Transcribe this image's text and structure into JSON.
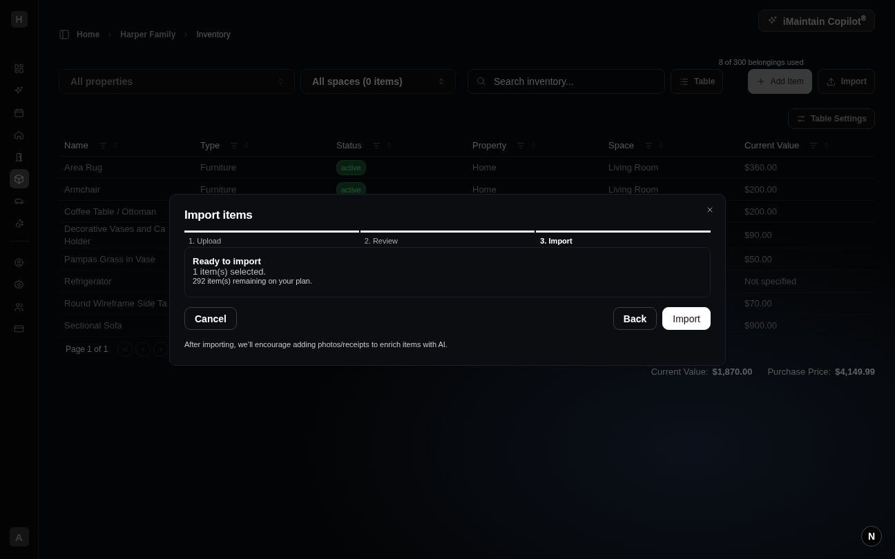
{
  "sidebar": {
    "logo": "H",
    "items": [
      {
        "kind": "grid",
        "selected": false
      },
      {
        "kind": "sparkles",
        "selected": false
      },
      {
        "kind": "calendar",
        "selected": false
      },
      {
        "kind": "home",
        "selected": false
      },
      {
        "kind": "door",
        "selected": false
      },
      {
        "kind": "box",
        "selected": true
      },
      {
        "kind": "car",
        "selected": false
      },
      {
        "kind": "paw",
        "selected": false
      }
    ],
    "bottom_items": [
      {
        "kind": "user"
      },
      {
        "kind": "gear"
      },
      {
        "kind": "users"
      },
      {
        "kind": "card"
      }
    ],
    "avatar": "A"
  },
  "copilot": {
    "label": "iMaintain Copilot",
    "mark": "®"
  },
  "breadcrumb": [
    {
      "label": "Home",
      "current": false
    },
    {
      "label": "Harper Family",
      "current": false
    },
    {
      "label": "Inventory",
      "current": true
    }
  ],
  "filters": [
    {
      "value": "All properties"
    },
    {
      "value": "All spaces (0 items)"
    }
  ],
  "search": {
    "placeholder": "Search inventory..."
  },
  "view_button": "Table",
  "usage": "8 of 300 belongings used",
  "add_button": "Add Item",
  "import_button": "Import",
  "table_settings": "Table Settings",
  "table": {
    "columns": [
      "Name",
      "Type",
      "Status",
      "Property",
      "Space",
      "Current Value"
    ],
    "rows": [
      {
        "name": "Area Rug",
        "type": "Furniture",
        "status": "active",
        "property": "Home",
        "space": "Living Room",
        "value": "$360.00"
      },
      {
        "name": "Armchair",
        "type": "Furniture",
        "status": "active",
        "property": "Home",
        "space": "Living Room",
        "value": "$200.00"
      },
      {
        "name": "Coffee Table / Ottoman",
        "value": "$200.00"
      },
      {
        "name": "Decorative Vases and Ca\nHolder",
        "value": "$90.00"
      },
      {
        "name": "Pampas Grass in Vase",
        "value": "$50.00"
      },
      {
        "name": "Refrigerator",
        "value": "Not specified"
      },
      {
        "name": "Round Wireframe Side Ta",
        "value": "$70.00"
      },
      {
        "name": "Sectional Sofa",
        "value": "$900.00"
      }
    ]
  },
  "pagination": {
    "label": "Page 1 of 1"
  },
  "totals": [
    {
      "label": "Current Value:",
      "value": "$1,870.00"
    },
    {
      "label": "Purchase Price:",
      "value": "$4,149.99"
    }
  ],
  "dialog": {
    "title": "Import items",
    "steps": [
      {
        "label": "1. Upload",
        "done": true,
        "selected": false
      },
      {
        "label": "2. Review",
        "done": true,
        "selected": false
      },
      {
        "label": "3. Import",
        "done": true,
        "selected": true
      }
    ],
    "heading": "Ready to import",
    "selected_text": "1 item(s) selected.",
    "remaining": "292 item(s) remaining on your plan.",
    "cancel": "Cancel",
    "back": "Back",
    "confirm": "Import",
    "note": "After importing, we’ll encourage adding photos/receipts to enrich items with AI."
  },
  "dev_badge": "N"
}
